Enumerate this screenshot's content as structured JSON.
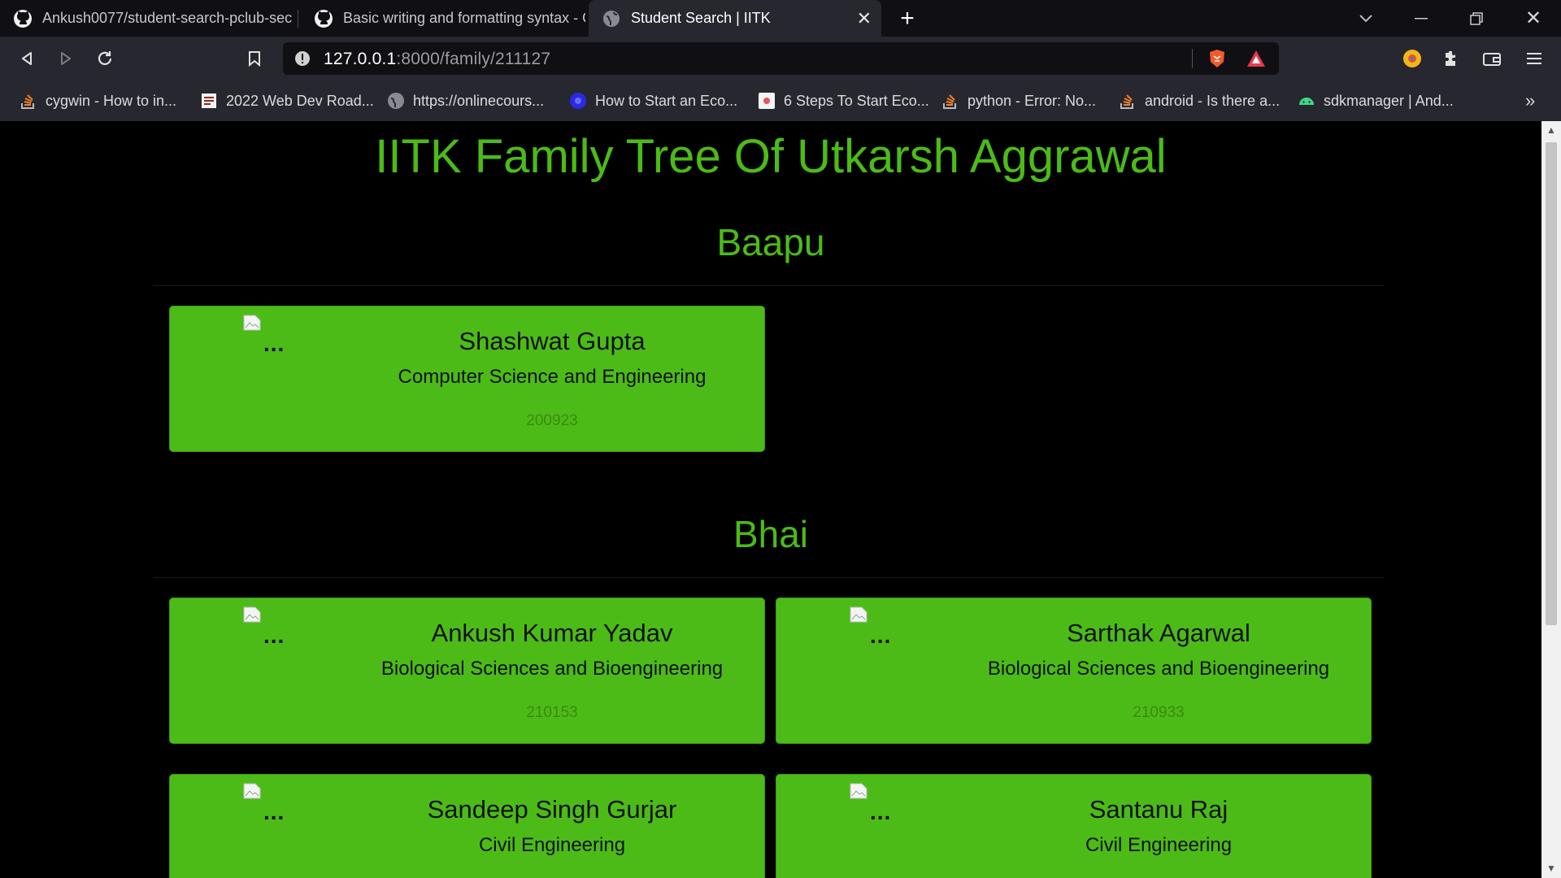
{
  "browser": {
    "tabs": [
      {
        "title": "Ankush0077/student-search-pclub-sec"
      },
      {
        "title": "Basic writing and formatting syntax - G"
      },
      {
        "title": "Student Search | IITK"
      }
    ],
    "url_host": "127.0.0.1",
    "url_path": ":8000/family/211127",
    "bookmarks": [
      {
        "label": "cygwin - How to in..."
      },
      {
        "label": "2022 Web Dev Road..."
      },
      {
        "label": "https://onlinecours..."
      },
      {
        "label": "How to Start an Eco..."
      },
      {
        "label": "6 Steps To Start Eco..."
      },
      {
        "label": "python - Error: No..."
      },
      {
        "label": "android - Is there a..."
      },
      {
        "label": "sdkmanager | And..."
      }
    ],
    "bookmarks_overflow": "»"
  },
  "page": {
    "title": "IITK Family Tree Of Utkarsh Aggrawal",
    "sections": [
      {
        "heading": "Baapu",
        "cards": [
          {
            "name": "Shashwat Gupta",
            "dept": "Computer Science and Engineering",
            "roll": "200923",
            "img_alt": "..."
          }
        ]
      },
      {
        "heading": "Bhai",
        "cards": [
          {
            "name": "Ankush Kumar Yadav",
            "dept": "Biological Sciences and Bioengineering",
            "roll": "210153",
            "img_alt": "..."
          },
          {
            "name": "Sarthak Agarwal",
            "dept": "Biological Sciences and Bioengineering",
            "roll": "210933",
            "img_alt": "..."
          },
          {
            "name": "Sandeep Singh Gurjar",
            "dept": "Civil Engineering",
            "roll": "",
            "img_alt": "..."
          },
          {
            "name": "Santanu Raj",
            "dept": "Civil Engineering",
            "roll": "",
            "img_alt": "..."
          }
        ]
      }
    ]
  },
  "colors": {
    "accent_green": "#4cbb17",
    "page_background": "#000000",
    "roll_text": "#3d8a10"
  }
}
